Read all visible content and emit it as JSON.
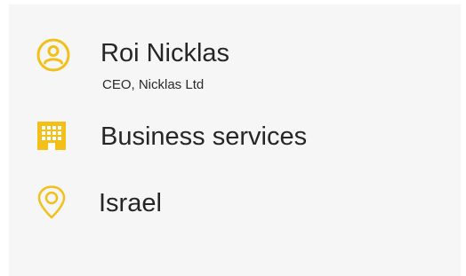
{
  "colors": {
    "accent": "#F2C018",
    "background": "#F6F6F6",
    "text": "#262626"
  },
  "profile": {
    "name": "Roi Nicklas",
    "title": "CEO, Nicklas Ltd",
    "person_icon": "person-icon"
  },
  "industry": {
    "label": "Business services",
    "icon": "building-icon"
  },
  "location": {
    "label": "Israel",
    "icon": "location-pin-icon"
  }
}
